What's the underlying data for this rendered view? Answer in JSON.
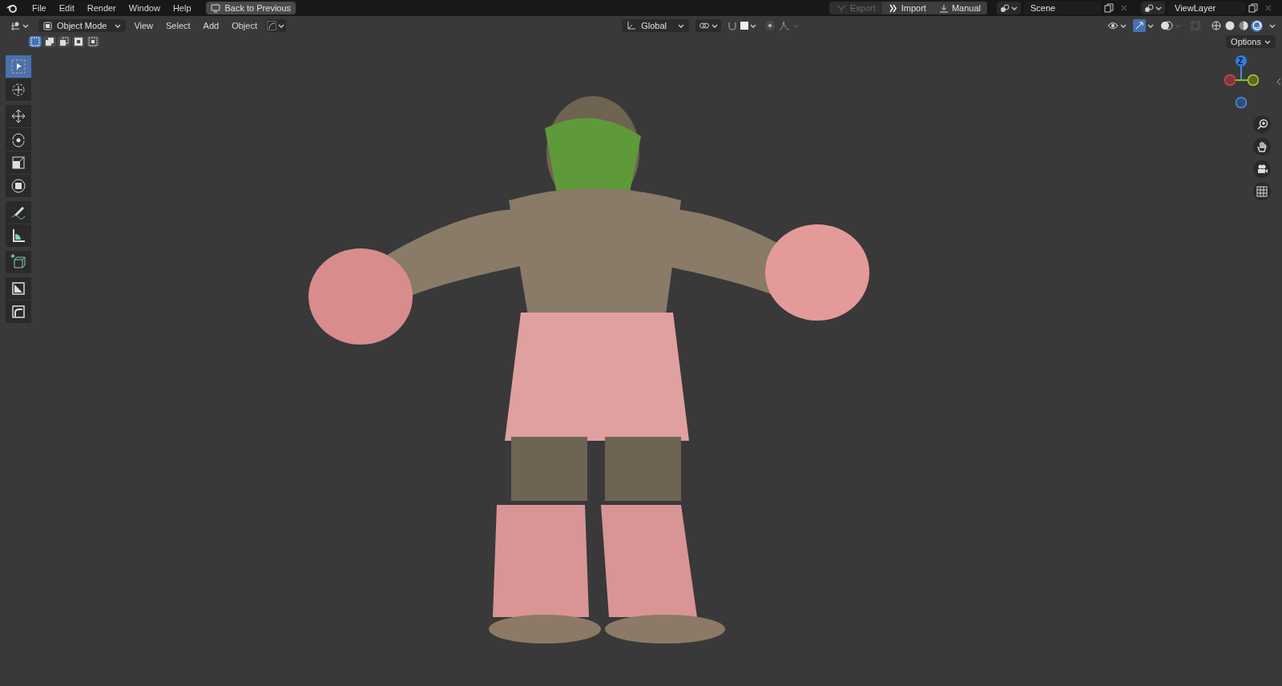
{
  "top_menu": [
    "File",
    "Edit",
    "Render",
    "Window",
    "Help"
  ],
  "back_button": "Back to Previous",
  "addon_buttons": [
    {
      "kind": "export",
      "label": "Export",
      "disabled": true
    },
    {
      "kind": "import",
      "label": "Import",
      "disabled": false
    },
    {
      "kind": "manual",
      "label": "Manual",
      "disabled": false
    }
  ],
  "scene_field": "Scene",
  "view_layer_field": "ViewLayer",
  "header": {
    "mode": "Object Mode",
    "menus": [
      "View",
      "Select",
      "Add",
      "Object"
    ],
    "orientation": "Global"
  },
  "select_modes": [
    {
      "kind": "set",
      "selected": true
    },
    {
      "kind": "extend",
      "selected": false
    },
    {
      "kind": "subtract",
      "selected": false
    },
    {
      "kind": "invert",
      "selected": false
    },
    {
      "kind": "intersect",
      "selected": false
    }
  ],
  "shading_modes": [
    {
      "kind": "wireframe",
      "selected": false
    },
    {
      "kind": "solid",
      "selected": false
    },
    {
      "kind": "material",
      "selected": false
    },
    {
      "kind": "rendered",
      "selected": true
    }
  ],
  "options_button": "Options",
  "tools": [
    {
      "kind": "select",
      "selected": true
    },
    {
      "kind": "cursor",
      "selected": false
    },
    {
      "kind": "move",
      "selected": false,
      "gap": true
    },
    {
      "kind": "rotate",
      "selected": false
    },
    {
      "kind": "scale",
      "selected": false
    },
    {
      "kind": "transform",
      "selected": false
    },
    {
      "kind": "annotate",
      "selected": false,
      "gap": true
    },
    {
      "kind": "measure",
      "selected": false
    },
    {
      "kind": "add-cube",
      "selected": false,
      "gap": true
    },
    {
      "kind": "shear",
      "selected": false,
      "gap": true
    },
    {
      "kind": "bend",
      "selected": false
    }
  ],
  "gizmo": {
    "z_label": "Z"
  }
}
